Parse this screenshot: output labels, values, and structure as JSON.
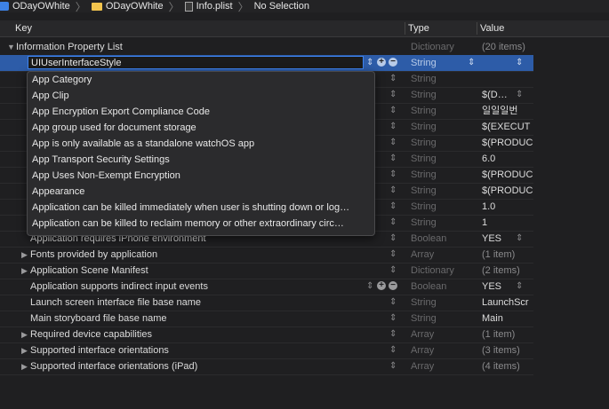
{
  "breadcrumb": [
    "ODayOWhite",
    "ODayOWhite",
    "Info.plist",
    "No Selection"
  ],
  "header": {
    "key": "Key",
    "type": "Type",
    "value": "Value"
  },
  "root": {
    "key": "Information Property List",
    "type": "Dictionary",
    "value": "(20 items)"
  },
  "editing": {
    "text": "UIUserInterfaceStyle",
    "type": "String"
  },
  "rows": [
    {
      "type": "String",
      "value": ""
    },
    {
      "type": "String",
      "value": "$(D…"
    },
    {
      "type": "String",
      "value": "일일일번"
    },
    {
      "type": "String",
      "value": "$(EXECUT"
    },
    {
      "type": "String",
      "value": "$(PRODUC"
    },
    {
      "type": "String",
      "value": "6.0"
    },
    {
      "type": "String",
      "value": "$(PRODUC"
    },
    {
      "type": "String",
      "value": "$(PRODUC"
    },
    {
      "type": "String",
      "value": "1.0"
    },
    {
      "type": "String",
      "value": "1"
    },
    {
      "key": "Application requires iPhone environment",
      "type": "Boolean",
      "value": "YES"
    },
    {
      "key": "Fonts provided by application",
      "type": "Array",
      "value": "(1 item)"
    },
    {
      "key": "Application Scene Manifest",
      "type": "Dictionary",
      "value": "(2 items)"
    },
    {
      "key": "Application supports indirect input events",
      "type": "Boolean",
      "value": "YES"
    },
    {
      "key": "Launch screen interface file base name",
      "type": "String",
      "value": "LaunchScr"
    },
    {
      "key": "Main storyboard file base name",
      "type": "String",
      "value": "Main"
    },
    {
      "key": "Required device capabilities",
      "type": "Array",
      "value": "(1 item)"
    },
    {
      "key": "Supported interface orientations",
      "type": "Array",
      "value": "(3 items)"
    },
    {
      "key": "Supported interface orientations (iPad)",
      "type": "Array",
      "value": "(4 items)"
    }
  ],
  "popup": [
    "App Category",
    "App Clip",
    "App Encryption Export Compliance Code",
    "App group used for document storage",
    "App is only available as a standalone watchOS app",
    "App Transport Security Settings",
    "App Uses Non-Exempt Encryption",
    "Appearance",
    "Application can be killed immediately when user is shutting down or log…",
    "Application can be killed to reclaim memory or other extraordinary circ…"
  ]
}
